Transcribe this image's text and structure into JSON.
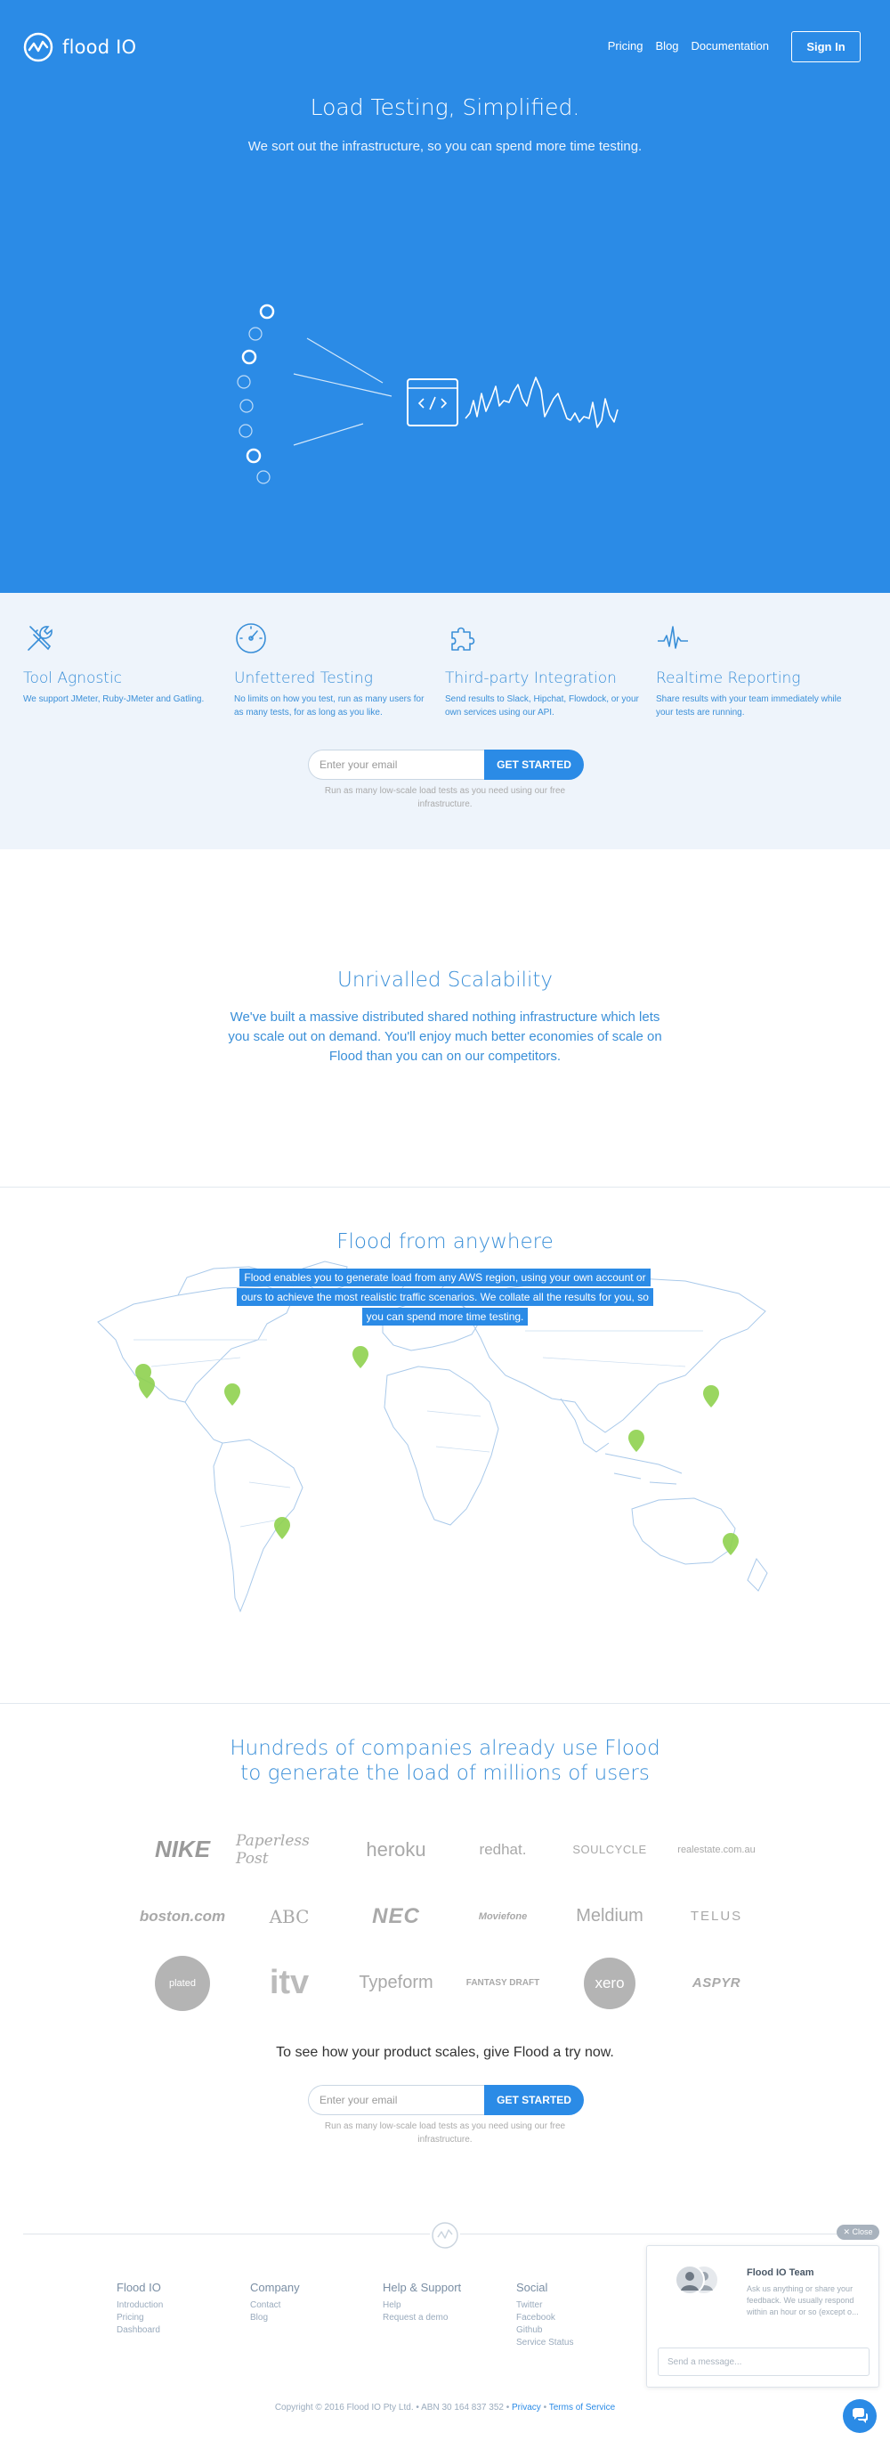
{
  "colors": {
    "brand_blue": "#2b8be6",
    "feature_bg": "#eef4fb",
    "heading_blue": "#3a8fd8",
    "pin_green": "#8fd14f"
  },
  "header": {
    "brand": "flood IO",
    "nav": [
      "Pricing",
      "Blog",
      "Documentation"
    ],
    "signin": "Sign In"
  },
  "hero": {
    "title": "Load Testing, Simplified.",
    "subtitle": "We sort out the infrastructure, so you can spend more time testing."
  },
  "features": [
    {
      "icon": "tools-icon",
      "title": "Tool Agnostic",
      "desc": "We support JMeter, Ruby-JMeter and Gatling."
    },
    {
      "icon": "speedometer-icon",
      "title": "Unfettered Testing",
      "desc": "No limits on how you test, run as many users for as many tests, for as long as you like."
    },
    {
      "icon": "puzzle-icon",
      "title": "Third-party Integration",
      "desc": "Send results to Slack, Hipchat, Flowdock, or your own services using our API."
    },
    {
      "icon": "pulse-icon",
      "title": "Realtime Reporting",
      "desc": "Share results with your team immediately while your tests are running."
    }
  ],
  "cta": {
    "placeholder": "Enter your email",
    "button": "GET STARTED",
    "note": "Run as many low-scale load tests as you need using our free infrastructure."
  },
  "scalability": {
    "title": "Unrivalled Scalability",
    "text": "We've built a massive distributed shared nothing infrastructure which lets you scale out on demand. You'll enjoy much better economies of scale on Flood than you can on our competitors."
  },
  "map": {
    "title": "Flood from anywhere",
    "text": "Flood enables you to generate load from any AWS region, using your own account or ours to achieve the most realistic traffic scenarios. We collate all the results for you, so you can spend more time testing."
  },
  "companies": {
    "title": "Hundreds of companies already use Flood to generate the load of millions of users",
    "logos": [
      "NIKE",
      "Paperless Post",
      "heroku",
      "redhat.",
      "SOULCYCLE",
      "realestate.com.au",
      "boston.com",
      "ABC",
      "NEC",
      "Moviefone",
      "Meldium",
      "TELUS",
      "plated",
      "itv",
      "Typeform",
      "FANTASY DRAFT",
      "xero",
      "ASPYR"
    ]
  },
  "try": {
    "title": "To see how your product scales, give Flood a try now."
  },
  "footer": {
    "columns": [
      {
        "heading": "Flood IO",
        "links": [
          "Introduction",
          "Pricing",
          "Dashboard"
        ]
      },
      {
        "heading": "Company",
        "links": [
          "Contact",
          "Blog"
        ]
      },
      {
        "heading": "Help & Support",
        "links": [
          "Help",
          "Request a demo"
        ]
      },
      {
        "heading": "Social",
        "links": [
          "Twitter",
          "Facebook",
          "Github",
          "Service Status"
        ]
      }
    ],
    "copyright": "Copyright © 2016 Flood IO Pty Ltd. • ABN 30 164 837 352 •",
    "privacy": "Privacy",
    "sep": "•",
    "terms": "Terms of Service"
  },
  "chat": {
    "close": "✕ Close",
    "team": "Flood IO Team",
    "desc": "Ask us anything or share your feedback. We usually respond within an hour or so (except o...",
    "placeholder": "Send a message..."
  }
}
